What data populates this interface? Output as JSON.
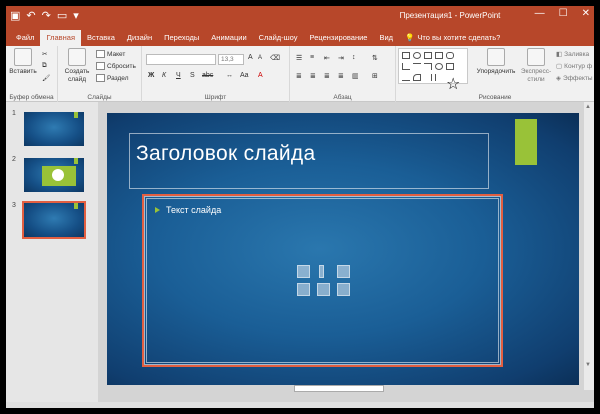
{
  "window": {
    "title": "Презентация1 - PowerPoint",
    "controls": [
      "—",
      "☐",
      "✕"
    ]
  },
  "qat": {
    "save_icon": "save-icon",
    "undo_icon": "undo-icon",
    "redo_icon": "redo-icon",
    "start_icon": "slideshow-start-icon",
    "customize_icon": "customize-qat-icon"
  },
  "tabs": [
    {
      "label": "Файл",
      "active": false
    },
    {
      "label": "Главная",
      "active": true
    },
    {
      "label": "Вставка",
      "active": false
    },
    {
      "label": "Дизайн",
      "active": false
    },
    {
      "label": "Переходы",
      "active": false
    },
    {
      "label": "Анимации",
      "active": false
    },
    {
      "label": "Слайд-шоу",
      "active": false
    },
    {
      "label": "Рецензирование",
      "active": false
    },
    {
      "label": "Вид",
      "active": false
    }
  ],
  "tell_me": "Что вы хотите сделать?",
  "ribbon": {
    "clipboard": {
      "label": "Буфер обмена",
      "paste": "Вставить",
      "cut_icon": "cut-icon",
      "copy_icon": "copy-icon",
      "format_painter_icon": "format-painter-icon"
    },
    "slides": {
      "label": "Слайды",
      "new_slide": "Создать слайд",
      "layout": "Макет",
      "reset": "Сбросить",
      "section": "Раздел"
    },
    "font": {
      "label": "Шрифт",
      "font_name": "",
      "font_size": "13,3",
      "bold": "Ж",
      "italic": "К",
      "underline": "Ч",
      "shadow": "S",
      "strike": "abc"
    },
    "paragraph": {
      "label": "Абзац"
    },
    "drawing": {
      "label": "Рисование",
      "arrange": "Упорядочить",
      "quick_styles": "Экспресс-стили",
      "fill": "Заливка",
      "outline": "Контур ф",
      "effects": "Эффекты"
    }
  },
  "thumbnails": [
    {
      "number": "1",
      "selected": false,
      "chart": false
    },
    {
      "number": "2",
      "selected": false,
      "chart": true
    },
    {
      "number": "3",
      "selected": true,
      "chart": false
    }
  ],
  "slide": {
    "title": "Заголовок слайда",
    "body": "Текст слайда"
  },
  "colors": {
    "accent": "#b7472a",
    "green_accent": "#99c238",
    "selection": "#e25f41",
    "slide_blue": "#1a5e96"
  }
}
